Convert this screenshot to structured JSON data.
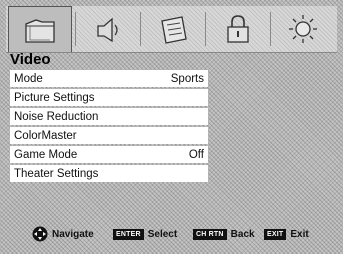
{
  "tabs": [
    {
      "icon": "picture-folder-icon",
      "active": true
    },
    {
      "icon": "audio-speaker-icon",
      "active": false
    },
    {
      "icon": "setup-list-icon",
      "active": false
    },
    {
      "icon": "lock-icon",
      "active": false
    },
    {
      "icon": "settings-sun-icon",
      "active": false
    }
  ],
  "menu": {
    "title": "Video",
    "items": [
      {
        "label": "Mode",
        "value": "Sports"
      },
      {
        "label": "Picture Settings",
        "value": ""
      },
      {
        "label": "Noise Reduction",
        "value": ""
      },
      {
        "label": "ColorMaster",
        "value": ""
      },
      {
        "label": "Game Mode",
        "value": "Off"
      },
      {
        "label": "Theater Settings",
        "value": ""
      }
    ]
  },
  "help": {
    "navigate": "Navigate",
    "select_key": "ENTER",
    "select": "Select",
    "back_key": "CH RTN",
    "back": "Back",
    "exit_key": "EXIT",
    "exit": "Exit"
  }
}
